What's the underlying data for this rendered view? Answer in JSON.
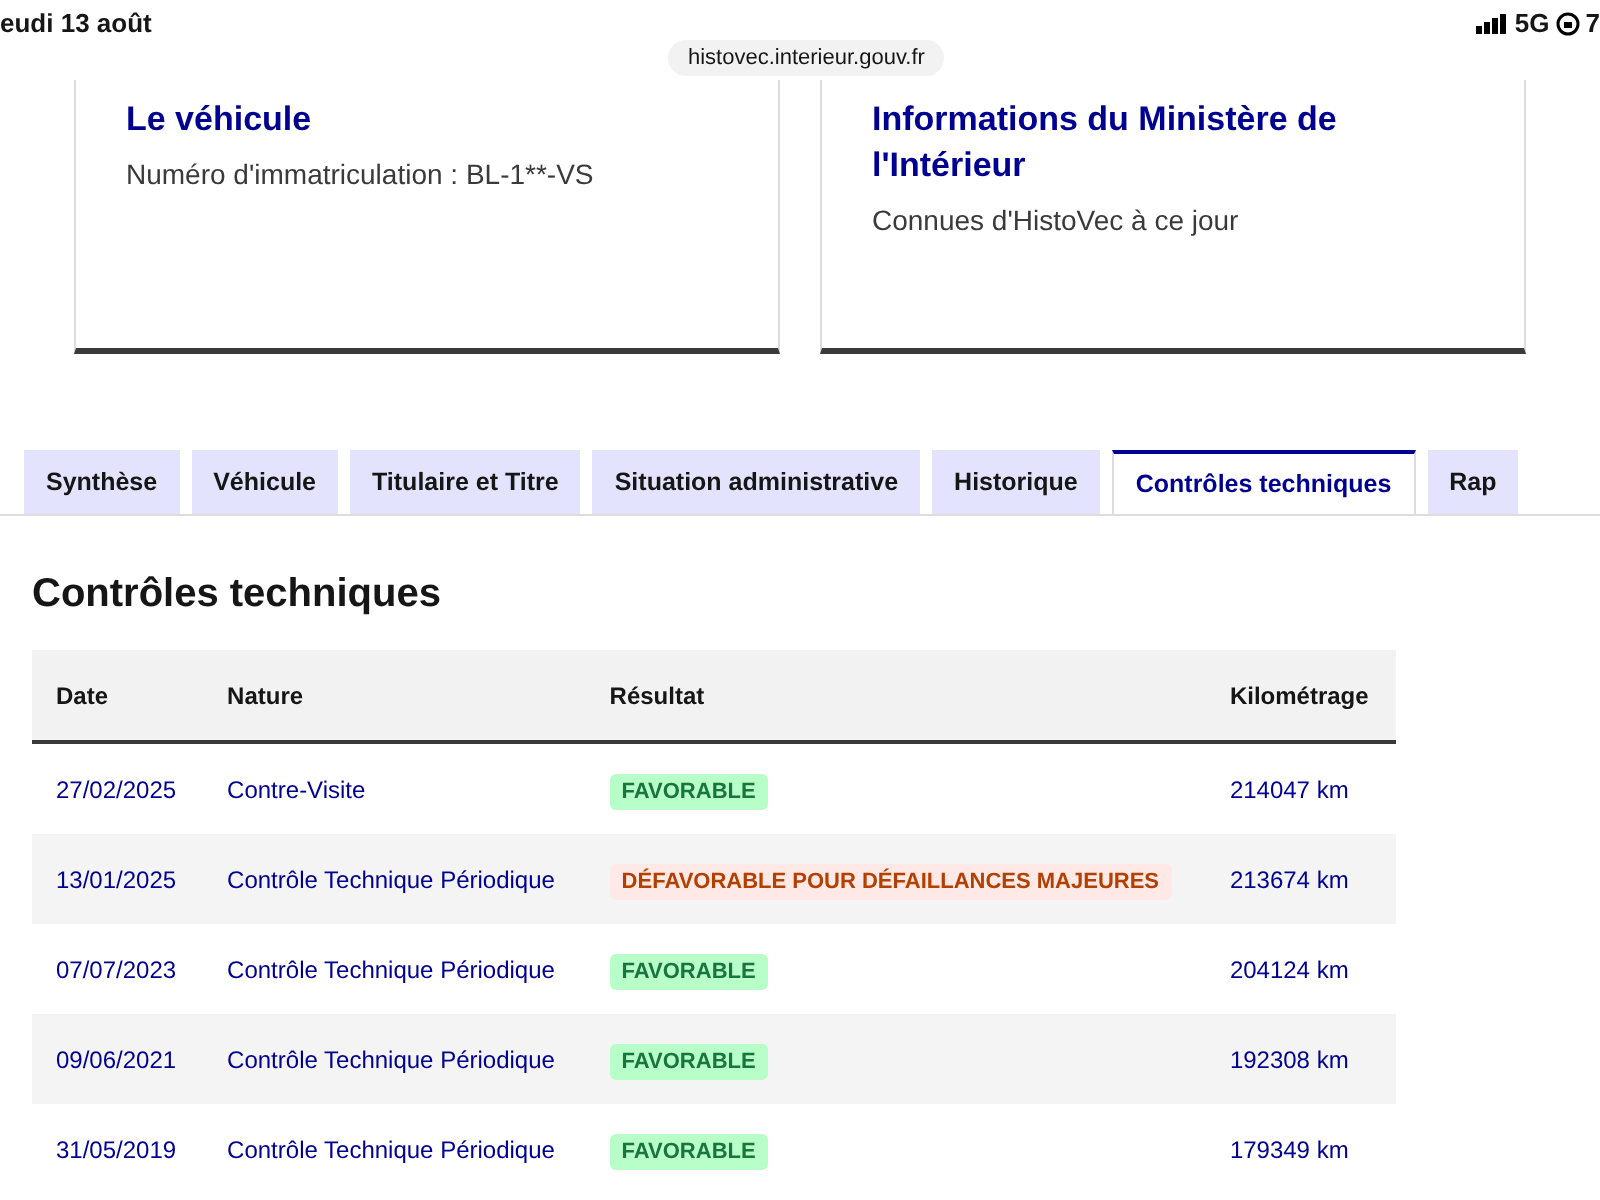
{
  "status_bar": {
    "date": "eudi 13 août",
    "url": "histovec.interieur.gouv.fr",
    "network": "5G",
    "battery": "7"
  },
  "cards": [
    {
      "title": "Le véhicule",
      "subtitle": "Numéro d'immatriculation : BL-1**-VS"
    },
    {
      "title": "Informations du Ministère de l'Intérieur",
      "subtitle": "Connues d'HistoVec à ce jour"
    }
  ],
  "tabs": [
    {
      "label": "Synthèse",
      "selected": false
    },
    {
      "label": "Véhicule",
      "selected": false
    },
    {
      "label": "Titulaire et Titre",
      "selected": false
    },
    {
      "label": "Situation administrative",
      "selected": false
    },
    {
      "label": "Historique",
      "selected": false
    },
    {
      "label": "Contrôles techniques",
      "selected": true
    },
    {
      "label": "Rap",
      "selected": false
    }
  ],
  "section_title": "Contrôles techniques",
  "table": {
    "columns": [
      "Date",
      "Nature",
      "Résultat",
      "Kilométrage"
    ],
    "rows": [
      {
        "date": "27/02/2025",
        "nature": "Contre-Visite",
        "result": "FAVORABLE",
        "kind": "success",
        "mileage": "214047 km"
      },
      {
        "date": "13/01/2025",
        "nature": "Contrôle Technique Périodique",
        "result": "DÉFAVORABLE POUR DÉFAILLANCES MAJEURES",
        "kind": "error",
        "mileage": "213674 km"
      },
      {
        "date": "07/07/2023",
        "nature": "Contrôle Technique Périodique",
        "result": "FAVORABLE",
        "kind": "success",
        "mileage": "204124 km"
      },
      {
        "date": "09/06/2021",
        "nature": "Contrôle Technique Périodique",
        "result": "FAVORABLE",
        "kind": "success",
        "mileage": "192308 km"
      },
      {
        "date": "31/05/2019",
        "nature": "Contrôle Technique Périodique",
        "result": "FAVORABLE",
        "kind": "success",
        "mileage": "179349 km"
      }
    ]
  }
}
